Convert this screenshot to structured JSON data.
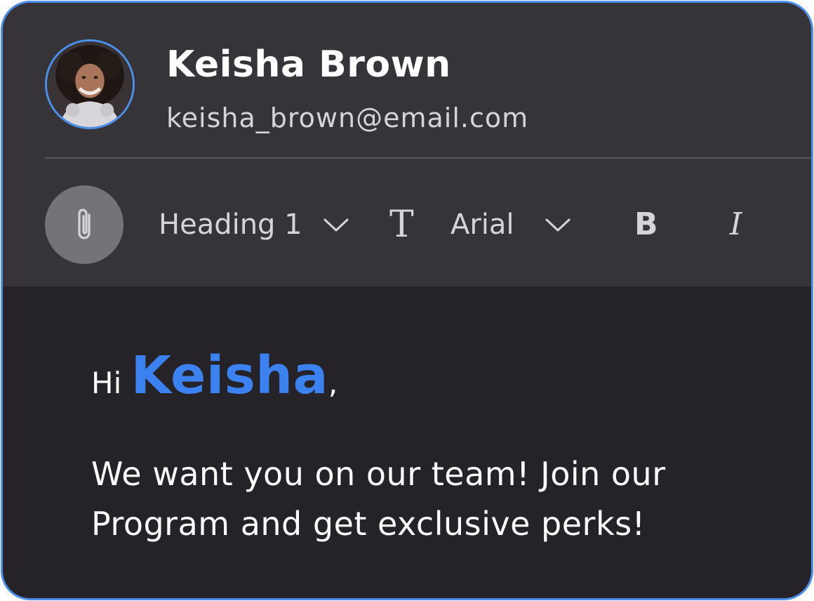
{
  "sender": {
    "name": "Keisha Brown",
    "email": "keisha_brown@email.com",
    "avatar_icon": "user-avatar-photo"
  },
  "toolbar": {
    "attach_icon": "paperclip-icon",
    "style_label": "Heading 1",
    "font_icon": "text-format-icon",
    "font_glyph": "T",
    "font_label": "Arial",
    "bold_label": "B",
    "italic_label": "I"
  },
  "body": {
    "greeting_prefix": "Hi",
    "greeting_name": "Keisha",
    "greeting_suffix": ",",
    "message": "We want you on our team! Join our Program and get exclusive perks!"
  },
  "colors": {
    "accent": "#3b82f0",
    "border": "#4a90ec",
    "header_bg": "#363438",
    "body_bg": "#252327"
  }
}
